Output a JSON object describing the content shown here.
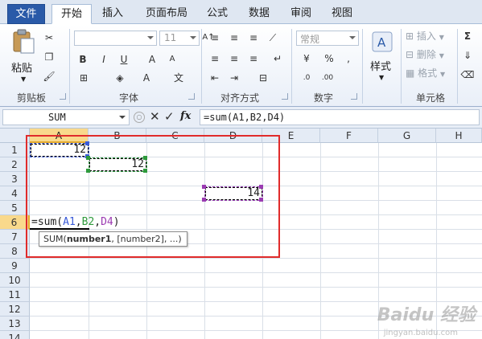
{
  "ribbon_tabs": [
    "文件",
    "开始",
    "插入",
    "页面布局",
    "公式",
    "数据",
    "审阅",
    "视图"
  ],
  "active_tab": "开始",
  "clipboard": {
    "paste_label": "粘贴",
    "group_label": "剪贴板"
  },
  "font": {
    "size_value": "11",
    "group_label": "字体"
  },
  "alignment": {
    "group_label": "对齐方式"
  },
  "number": {
    "format_value": "常规",
    "group_label": "数字"
  },
  "styles": {
    "label": "样式"
  },
  "cells": {
    "insert_label": "插入",
    "delete_label": "删除",
    "format_label": "格式",
    "group_label": "单元格"
  },
  "editing": {
    "sum_symbol": "Σ"
  },
  "formula_bar": {
    "name_box": "SUM",
    "formula": "=sum(A1,B2,D4)",
    "fx_label": "fx"
  },
  "columns": [
    "A",
    "B",
    "C",
    "D",
    "E",
    "F",
    "G",
    "H"
  ],
  "rows": [
    "1",
    "2",
    "3",
    "4",
    "5",
    "6",
    "7",
    "8",
    "9",
    "10",
    "11",
    "12",
    "13",
    "14"
  ],
  "cell_values": {
    "A1": "12",
    "B2": "12",
    "D4": "14"
  },
  "edit_cell": {
    "prefix": "=sum(",
    "ref1": "A1",
    "sep1": ",",
    "ref2": "B2",
    "sep2": ",",
    "ref3": "D4",
    "suffix": ")"
  },
  "tooltip": {
    "func": "SUM(",
    "arg1": "number1",
    "rest": ", [number2], ...)"
  },
  "watermark": {
    "brand": "Baidu 经验",
    "url": "jingyan.baidu.com"
  },
  "colors": {
    "ref_blue": "#3a5bd8",
    "ref_green": "#2e9a3c",
    "ref_purple": "#9b3bb2",
    "highlight_red": "#e02b2b"
  }
}
